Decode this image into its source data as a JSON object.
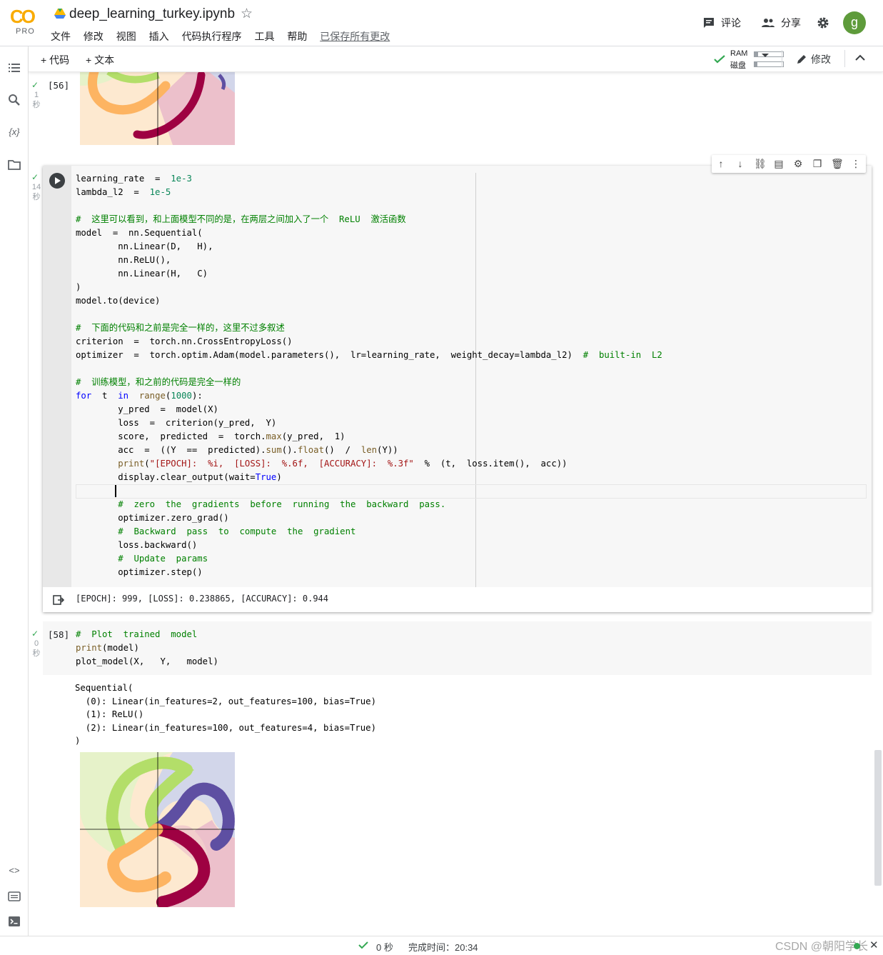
{
  "app": {
    "logo_text": "CO",
    "tier": "PRO",
    "notebook_title": "deep_learning_turkey.ipynb",
    "menu": [
      "文件",
      "修改",
      "视图",
      "插入",
      "代码执行程序",
      "工具",
      "帮助"
    ],
    "save_status": "已保存所有更改",
    "comment_label": "评论",
    "share_label": "分享",
    "avatar_letter": "g"
  },
  "toolbar": {
    "add_code": "+ 代码",
    "add_text": "+ 文本",
    "ram_label": "RAM",
    "disk_label": "磁盘",
    "ram_usage": 0.12,
    "disk_usage": 0.1,
    "edit_label": "修改"
  },
  "cells": [
    {
      "id": "cell-56",
      "exec_count": "[56]",
      "duration_value": "1",
      "duration_unit": "秒"
    },
    {
      "id": "cell-57",
      "duration_value": "14",
      "duration_unit": "秒",
      "code_lines": [
        "learning_rate  =  1e-3",
        "lambda_l2  =  1e-5",
        "",
        "#  这里可以看到，和上面模型不同的是，在两层之间加入了一个  ReLU  激活函数",
        "model  =  nn.Sequential(",
        "        nn.Linear(D,   H),",
        "        nn.ReLU(),",
        "        nn.Linear(H,   C)",
        ")",
        "model.to(device)",
        "",
        "#  下面的代码和之前是完全一样的，这里不过多叙述",
        "criterion  =  torch.nn.CrossEntropyLoss()",
        "optimizer  =  torch.optim.Adam(model.parameters(),  lr=learning_rate,  weight_decay=lambda_l2)  #  built-in  L2",
        "",
        "#  训练模型，和之前的代码是完全一样的",
        "for  t  in  range(1000):",
        "        y_pred  =  model(X)",
        "        loss  =  criterion(y_pred,  Y)",
        "        score,  predicted  =  torch.max(y_pred,  1)",
        "        acc  =  ((Y  ==  predicted).sum().float()  /  len(Y))",
        "        print(\"[EPOCH]:  %i,  [LOSS]:  %.6f,  [ACCURACY]:  %.3f\"  %  (t,  loss.item(),  acc))",
        "        display.clear_output(wait=True)",
        "",
        "        #  zero  the  gradients  before  running  the  backward  pass.",
        "        optimizer.zero_grad()",
        "        #  Backward  pass  to  compute  the  gradient",
        "        loss.backward()",
        "        #  Update  params",
        "        optimizer.step()"
      ],
      "output": "[EPOCH]: 999,  [LOSS]: 0.238865,  [ACCURACY]: 0.944"
    },
    {
      "id": "cell-58",
      "exec_count": "[58]",
      "duration_value": "0",
      "duration_unit": "秒",
      "code_lines": [
        "#  Plot  trained  model",
        "print(model)",
        "plot_model(X,   Y,   model)"
      ],
      "output_lines": [
        "Sequential(",
        "  (0): Linear(in_features=2, out_features=100, bias=True)",
        "  (1): ReLU()",
        "  (2): Linear(in_features=100, out_features=4, bias=True)",
        ")"
      ]
    }
  ],
  "colors": {
    "orange": "#fdb462",
    "green": "#b3de69",
    "purple": "#5e4fa2",
    "crimson": "#9e0142",
    "check": "#34a853"
  },
  "statusbar": {
    "elapsed": "0 秒",
    "finish_label": "完成时间：20:34",
    "watermark": "CSDN @朝阳学长"
  }
}
